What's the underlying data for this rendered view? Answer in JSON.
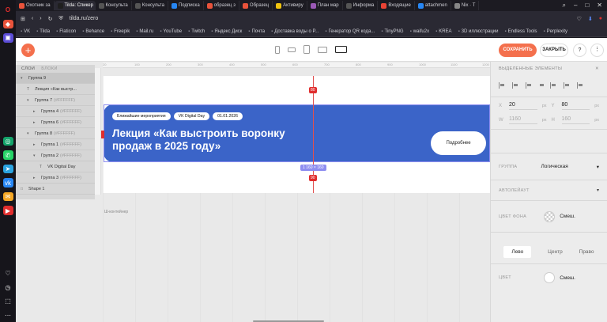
{
  "browser": {
    "tabs": [
      {
        "label": "Охотник за",
        "color": "#e9533b"
      },
      {
        "label": "Tilda: Спикер",
        "color": "#1f1f1f",
        "active": true
      },
      {
        "label": "Консульта",
        "color": "#555"
      },
      {
        "label": "Консульта",
        "color": "#555"
      },
      {
        "label": "Подписка",
        "color": "#2787f5"
      },
      {
        "label": "образец з",
        "color": "#e9533b"
      },
      {
        "label": "Образец",
        "color": "#e9533b"
      },
      {
        "label": "Активиру",
        "color": "#f1c40f"
      },
      {
        "label": "План мар",
        "color": "#9b59b6"
      },
      {
        "label": "Информа",
        "color": "#555"
      },
      {
        "label": "Входящие",
        "color": "#ea4335"
      },
      {
        "label": "attachmen",
        "color": "#2787f5"
      },
      {
        "label": "Nix · T",
        "color": "#888"
      }
    ],
    "url": "tilda.ru/zero",
    "bookmarks": [
      "VK",
      "Tilda",
      "Flaticon",
      "Behance",
      "Freepik",
      "Mail.ru",
      "YouTube",
      "Twitch",
      "Яндекс Диск",
      "Почта",
      "Доставка воды о Р...",
      "Генератор QR кода...",
      "TinyPNG",
      "waifu2x",
      "KREA",
      "3D иллюстрации",
      "Endless Tools",
      "Perplexity"
    ]
  },
  "toolbar": {
    "add": "+",
    "save": "СОХРАНИТЬ",
    "close": "ЗАКРЫТЬ",
    "help": "?",
    "more": "⋮"
  },
  "layers": {
    "tab_layers": "СЛОИ",
    "tab_blocks": "БЛОКИ",
    "items": [
      {
        "label": "Группа 9",
        "muted": "",
        "indent": 0,
        "icon": "▾",
        "selected": true
      },
      {
        "label": "Лекция «Как выстр...",
        "muted": "",
        "indent": 1,
        "icon": "T"
      },
      {
        "label": "Группа 7",
        "muted": "(#FFFFFF)",
        "indent": 1,
        "icon": "▾"
      },
      {
        "label": "Группа 4",
        "muted": "(#FFFFFF)",
        "indent": 2,
        "icon": "▸"
      },
      {
        "label": "Группа 6",
        "muted": "(#FFFFFF)",
        "indent": 2,
        "icon": "▸"
      },
      {
        "label": "Группа 8",
        "muted": "(#FFFFFF)",
        "indent": 1,
        "icon": "▾"
      },
      {
        "label": "Группа 1",
        "muted": "(#FFFFFF)",
        "indent": 2,
        "icon": "▸"
      },
      {
        "label": "Группа 2",
        "muted": "(#FFFFFF)",
        "indent": 2,
        "icon": "▾"
      },
      {
        "label": "VK Digital Day",
        "muted": "",
        "indent": 3,
        "icon": "T"
      },
      {
        "label": "Группа 3",
        "muted": "(#FFFFFF)",
        "indent": 2,
        "icon": "▸"
      },
      {
        "label": "Shape 1",
        "muted": "",
        "indent": 0,
        "icon": "□"
      }
    ]
  },
  "canvas": {
    "chips": [
      "Ближайшие мероприятия",
      "VK Digital Day",
      "01.01.2026"
    ],
    "headline": "Лекция «Как выстроить воронку продаж в 2025 году»",
    "button": "Подробнее",
    "badge_top": "80",
    "badge_bottom": "90",
    "size_badge": "1 160 × 160",
    "container_label": "Ш-контейнер",
    "ruler_marks": [
      "20",
      "100",
      "200",
      "300",
      "400",
      "500",
      "600",
      "700",
      "800",
      "900",
      "1000",
      "1100",
      "1200"
    ]
  },
  "panel": {
    "title": "ВЫДЕЛЕННЫЕ ЭЛЕМЕНТЫ",
    "x_label": "X",
    "x_value": "20",
    "y_label": "Y",
    "y_value": "80",
    "w_label": "W",
    "w_value": "1160",
    "h_label": "H",
    "h_value": "160",
    "unit": "px",
    "group_label": "ГРУППА",
    "group_value": "Логическая",
    "autolayout_label": "АВТОЛЕЙАУТ",
    "bg_label": "ЦВЕТ ФОНА",
    "bg_value": "Смеш.",
    "align_tabs": [
      "Лево",
      "Центр",
      "Право"
    ],
    "color_label": "ЦВЕТ",
    "color_value": "Смеш."
  }
}
